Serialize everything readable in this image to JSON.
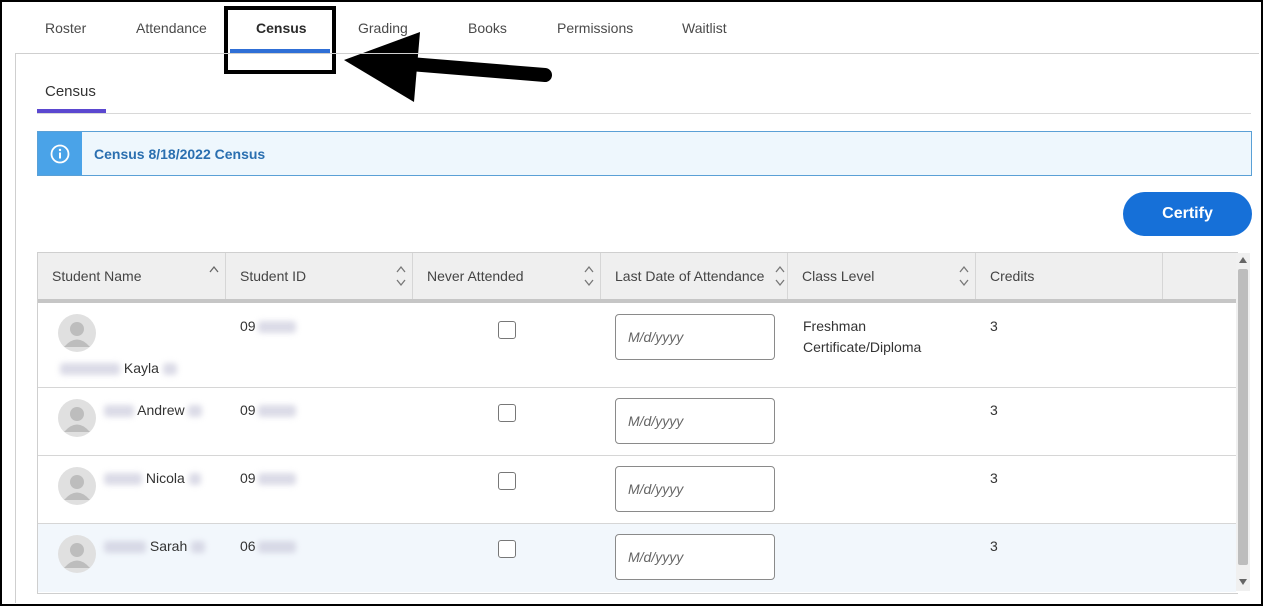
{
  "tabs": [
    "Roster",
    "Attendance",
    "Census",
    "Grading",
    "Books",
    "Permissions",
    "Waitlist"
  ],
  "subtab": "Census",
  "banner": {
    "text": "Census 8/18/2022 Census",
    "icon": "info-icon"
  },
  "certify_label": "Certify",
  "table": {
    "headers": [
      "Student Name",
      "Student ID",
      "Never Attended",
      "Last Date of Attendance",
      "Class Level",
      "Credits"
    ],
    "date_placeholder": "M/d/yyyy",
    "rows": [
      {
        "first_name": "Kayla",
        "id_prefix": "09",
        "class_level_1": "Freshman",
        "class_level_2": "Certificate/Diploma",
        "credits": "3"
      },
      {
        "first_name": "Andrew",
        "id_prefix": "09",
        "class_level_1": "",
        "class_level_2": "",
        "credits": "3"
      },
      {
        "first_name": "Nicola",
        "id_prefix": "09",
        "class_level_1": "",
        "class_level_2": "",
        "credits": "3"
      },
      {
        "first_name": "Sarah",
        "id_prefix": "06",
        "class_level_1": "",
        "class_level_2": "",
        "credits": "3"
      }
    ]
  },
  "colors": {
    "accent": "#1670d8",
    "tab_underline": "#2f6fd6",
    "subtab_underline": "#5b48d0",
    "banner_icon": "#4aa3e8"
  }
}
